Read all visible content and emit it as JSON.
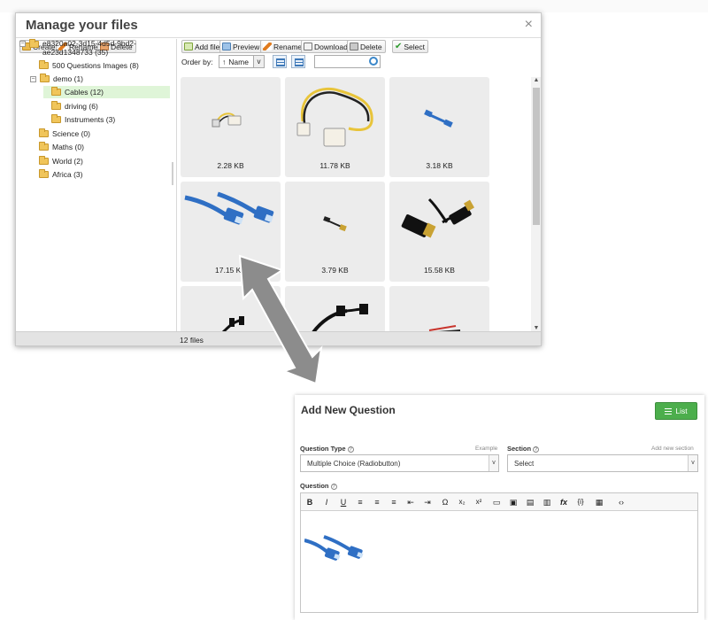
{
  "file_manager": {
    "title": "Manage your files",
    "close_glyph": "×",
    "left_toolbar": [
      {
        "label": "Create",
        "icon": "folder-add-icon"
      },
      {
        "label": "Rename",
        "icon": "pencil-icon"
      },
      {
        "label": "Delete",
        "icon": "folder-delete-icon"
      }
    ],
    "right_toolbar": [
      {
        "label": "Add file",
        "icon": "add-file-icon"
      },
      {
        "label": "Preview",
        "icon": "preview-icon"
      },
      {
        "label": "Rename",
        "icon": "pencil-icon"
      },
      {
        "label": "Download",
        "icon": "download-icon"
      },
      {
        "label": "Delete",
        "icon": "trash-icon"
      },
      {
        "label": "Select",
        "icon": "check-icon"
      }
    ],
    "tree": {
      "root_line1": "e8320a02-3d15-4d5d-9bd2-",
      "root_line2": "ae23d1348733 (35)",
      "items": [
        {
          "label": "500 Questions Images (8)"
        },
        {
          "label": "demo (1)"
        },
        {
          "label": "Cables (12)"
        },
        {
          "label": "driving (6)"
        },
        {
          "label": "Instruments (3)"
        },
        {
          "label": "Science (0)"
        },
        {
          "label": "Maths (0)"
        },
        {
          "label": "World (2)"
        },
        {
          "label": "Africa (3)"
        }
      ],
      "toggle_collapse": "−"
    },
    "order_by_label": "Order by:",
    "order_by_value": "Name",
    "sort_direction_glyph": "↑",
    "dropdown_glyph": "v",
    "search_value": "",
    "files": [
      {
        "size": "2.28 KB"
      },
      {
        "size": "11.78 KB"
      },
      {
        "size": "3.18 KB"
      },
      {
        "size": "17.15 KB"
      },
      {
        "size": "3.79 KB"
      },
      {
        "size": "15.58 KB"
      },
      {
        "size": ""
      },
      {
        "size": ""
      },
      {
        "size": ""
      }
    ],
    "status": "12 files"
  },
  "add_question": {
    "title": "Add New Question",
    "list_button": "List",
    "question_type_label": "Question Type",
    "question_type_hint": "Example",
    "question_type_value": "Multiple Choice (Radiobutton)",
    "section_label": "Section",
    "section_hint": "Add new section",
    "section_value": "Select",
    "question_label": "Question",
    "help_glyph": "?",
    "caret_glyph": "v",
    "editor_toolbar": [
      {
        "label": "B",
        "icon": "bold-icon"
      },
      {
        "label": "I",
        "icon": "italic-icon"
      },
      {
        "label": "U",
        "icon": "underline-icon"
      },
      {
        "label": "≡",
        "icon": "align-left-icon"
      },
      {
        "label": "≡",
        "icon": "align-center-icon"
      },
      {
        "label": "≡",
        "icon": "align-right-icon"
      },
      {
        "label": "⇤",
        "icon": "outdent-icon"
      },
      {
        "label": "⇥",
        "icon": "indent-icon"
      },
      {
        "label": "Ω",
        "icon": "special-char-icon"
      },
      {
        "label": "x₂",
        "icon": "subscript-icon"
      },
      {
        "label": "x²",
        "icon": "superscript-icon"
      },
      {
        "label": "▭",
        "icon": "media-icon"
      },
      {
        "label": "▣",
        "icon": "image-icon"
      },
      {
        "label": "▤",
        "icon": "file-manager-icon"
      },
      {
        "label": "▥",
        "icon": "document-icon"
      },
      {
        "label": "fx",
        "icon": "formula-icon"
      },
      {
        "label": "{i}",
        "icon": "variable-icon"
      },
      {
        "label": "▦",
        "icon": "table-icon"
      },
      {
        "label": "‹›",
        "icon": "source-code-icon"
      }
    ]
  },
  "colors": {
    "accent_green": "#4cae4c",
    "selected_folder_bg": "#dff5d8",
    "cable_blue": "#2f6fc4",
    "arrow_gray": "#8c8c8c"
  }
}
